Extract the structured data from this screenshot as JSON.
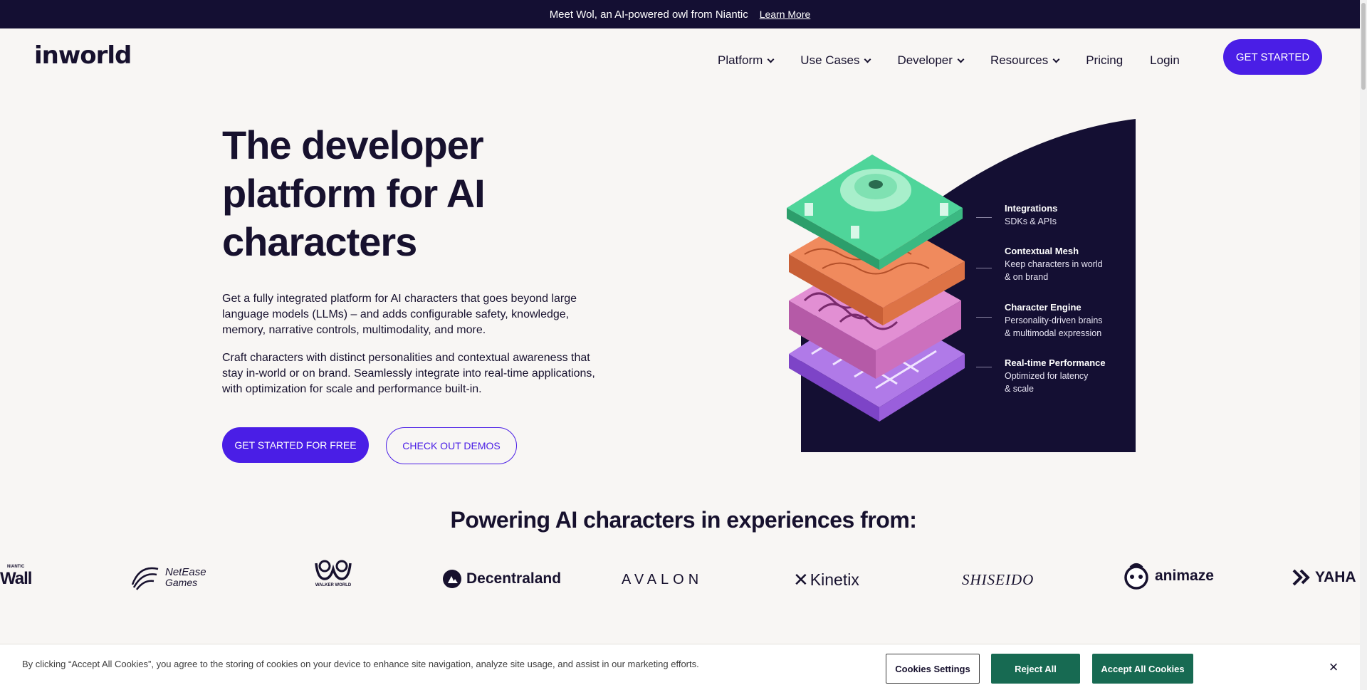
{
  "announcement": {
    "text": "Meet Wol, an AI-powered owl from Niantic",
    "link": "Learn More"
  },
  "header": {
    "logo": "inworld",
    "nav": [
      {
        "label": "Platform",
        "dropdown": true
      },
      {
        "label": "Use Cases",
        "dropdown": true
      },
      {
        "label": "Developer",
        "dropdown": true
      },
      {
        "label": "Resources",
        "dropdown": true
      },
      {
        "label": "Pricing",
        "dropdown": false
      },
      {
        "label": "Login",
        "dropdown": false
      }
    ],
    "cta": "GET STARTED"
  },
  "hero": {
    "title_line1": "The developer",
    "title_line2": "platform for AI",
    "title_line3": "characters",
    "paragraph1": "Get a fully integrated platform for AI characters that goes beyond large language models (LLMs) – and adds configurable safety, knowledge, memory, narrative controls, multimodality, and more.",
    "paragraph2": "Craft characters with distinct personalities and contextual awareness that stay in-world or on brand. Seamlessly integrate into real-time applications, with optimization for scale and performance built-in.",
    "primary_cta": "GET STARTED FOR FREE",
    "secondary_cta": "CHECK OUT DEMOS"
  },
  "features": [
    {
      "title": "Integrations",
      "sub1": "SDKs & APIs",
      "sub2": ""
    },
    {
      "title": "Contextual Mesh",
      "sub1": "Keep characters in world",
      "sub2": "& on brand"
    },
    {
      "title": "Character Engine",
      "sub1": "Personality-driven brains",
      "sub2": "& multimodal expression"
    },
    {
      "title": "Real-time Performance",
      "sub1": "Optimized for latency",
      "sub2": "& scale"
    }
  ],
  "partners": {
    "heading": "Powering AI characters in experiences from:",
    "logos": [
      {
        "name": "Wall",
        "small": "NIANTIC"
      },
      {
        "name": "NetEase",
        "small": "Games"
      },
      {
        "name": "",
        "small": "WALKER WORLD"
      },
      {
        "name": "Decentraland",
        "small": ""
      },
      {
        "name": "AVALON",
        "small": ""
      },
      {
        "name": "Kinetix",
        "small": ""
      },
      {
        "name": "SHISEIDO",
        "small": ""
      },
      {
        "name": "animaze",
        "small": ""
      },
      {
        "name": "YAHA",
        "small": ""
      }
    ]
  },
  "cookie": {
    "text": "By clicking “Accept All Cookies”, you agree to the storing of cookies on your device to enhance site navigation, analyze site usage, and assist in our marketing efforts.",
    "settings": "Cookies Settings",
    "reject": "Reject All",
    "accept": "Accept All Cookies",
    "close": "×"
  },
  "colors": {
    "brand": "#4a1ee6",
    "dark": "#140f33",
    "cookie_green": "#176a52"
  }
}
